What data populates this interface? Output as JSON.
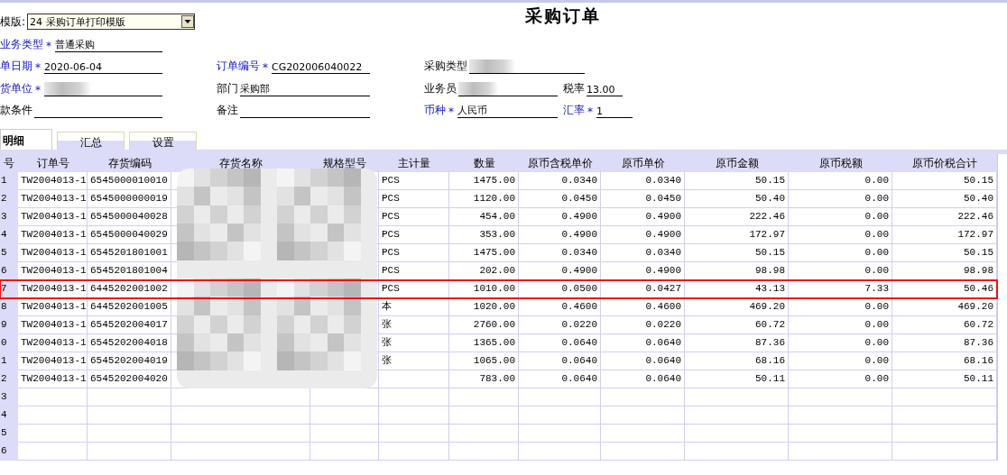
{
  "template": {
    "label": "模版:",
    "value": "24 采购订单打印模版"
  },
  "title": "采购订单",
  "form_rows": [
    [
      {
        "label": "业务类型",
        "required": true,
        "mark": "*",
        "value": "普通采购",
        "redacted": false
      }
    ],
    [
      {
        "label": "单日期",
        "required": true,
        "mark": "*",
        "value": "2020-06-04",
        "redacted": false
      },
      {
        "label": "订单编号",
        "required": true,
        "mark": "*",
        "value": "CG202006040022",
        "redacted": false
      },
      {
        "label": "采购类型",
        "required": false,
        "redacted": true
      }
    ],
    [
      {
        "label": "货单位",
        "required": true,
        "mark": "*",
        "redacted": true
      },
      {
        "label": "部门",
        "required": false,
        "value": "采购部",
        "redacted": false
      },
      {
        "label": "业务员",
        "required": false,
        "redacted": true
      },
      {
        "label": "税率",
        "required": false,
        "value": "13.00",
        "redacted": false
      }
    ],
    [
      {
        "label": "款条件",
        "required": false,
        "redacted": false
      },
      {
        "label": "备注",
        "required": false,
        "redacted": false
      },
      {
        "label": "币种",
        "required": true,
        "mark": "*",
        "value": "人民币",
        "redacted": false
      },
      {
        "label": "汇率",
        "required": true,
        "mark": "*",
        "value": "1",
        "redacted": false
      }
    ]
  ],
  "tabs": [
    {
      "label": "明细",
      "selected": true
    },
    {
      "label": "汇总",
      "selected": false
    },
    {
      "label": "设置",
      "selected": false
    }
  ],
  "table": {
    "columns": [
      {
        "label": "号",
        "kind": "index"
      },
      {
        "label": "订单号",
        "kind": "text"
      },
      {
        "label": "存货编码",
        "kind": "text"
      },
      {
        "label": "存货名称",
        "kind": "text"
      },
      {
        "label": "规格型号",
        "kind": "text"
      },
      {
        "label": "主计量",
        "kind": "text"
      },
      {
        "label": "数量",
        "kind": "number"
      },
      {
        "label": "原币含税单价",
        "kind": "number"
      },
      {
        "label": "原币单价",
        "kind": "number"
      },
      {
        "label": "原币金额",
        "kind": "number"
      },
      {
        "label": "原币税额",
        "kind": "number"
      },
      {
        "label": "原币价税合计",
        "kind": "number"
      }
    ],
    "rows": [
      {
        "cells": [
          "1",
          "TW2004013-1",
          "6545000010010",
          null,
          null,
          "PCS",
          "1475.00",
          "0.0340",
          "0.0340",
          "50.15",
          "0.00",
          "50.15"
        ],
        "highlighted": false
      },
      {
        "cells": [
          "2",
          "TW2004013-1",
          "6545000000019",
          null,
          null,
          "PCS",
          "1120.00",
          "0.0450",
          "0.0450",
          "50.40",
          "0.00",
          "50.40"
        ],
        "highlighted": false
      },
      {
        "cells": [
          "3",
          "TW2004013-1",
          "6545000040028",
          null,
          null,
          "PCS",
          "454.00",
          "0.4900",
          "0.4900",
          "222.46",
          "0.00",
          "222.46"
        ],
        "highlighted": false
      },
      {
        "cells": [
          "4",
          "TW2004013-1",
          "6545000040029",
          null,
          null,
          "PCS",
          "353.00",
          "0.4900",
          "0.4900",
          "172.97",
          "0.00",
          "172.97"
        ],
        "highlighted": false
      },
      {
        "cells": [
          "5",
          "TW2004013-1",
          "6545201801001",
          null,
          null,
          "PCS",
          "1475.00",
          "0.0340",
          "0.0340",
          "50.15",
          "0.00",
          "50.15"
        ],
        "highlighted": false
      },
      {
        "cells": [
          "6",
          "TW2004013-1",
          "6545201801004",
          null,
          null,
          "PCS",
          "202.00",
          "0.4900",
          "0.4900",
          "98.98",
          "0.00",
          "98.98"
        ],
        "highlighted": false
      },
      {
        "cells": [
          "7",
          "TW2004013-1",
          "6445202001002",
          null,
          null,
          "PCS",
          "1010.00",
          "0.0500",
          "0.0427",
          "43.13",
          "7.33",
          "50.46"
        ],
        "highlighted": true
      },
      {
        "cells": [
          "8",
          "TW2004013-1",
          "6445202001005",
          null,
          null,
          "本",
          "1020.00",
          "0.4600",
          "0.4600",
          "469.20",
          "0.00",
          "469.20"
        ],
        "highlighted": false
      },
      {
        "cells": [
          "9",
          "TW2004013-1",
          "6545202004017",
          null,
          null,
          "张",
          "2760.00",
          "0.0220",
          "0.0220",
          "60.72",
          "0.00",
          "60.72"
        ],
        "highlighted": false
      },
      {
        "cells": [
          "0",
          "TW2004013-1",
          "6545202004018",
          null,
          null,
          "张",
          "1365.00",
          "0.0640",
          "0.0640",
          "87.36",
          "0.00",
          "87.36"
        ],
        "highlighted": false
      },
      {
        "cells": [
          "1",
          "TW2004013-1",
          "6545202004019",
          null,
          null,
          "张",
          "1065.00",
          "0.0640",
          "0.0640",
          "68.16",
          "0.00",
          "68.16"
        ],
        "highlighted": false
      },
      {
        "cells": [
          "2",
          "TW2004013-1",
          "6545202004020",
          null,
          null,
          null,
          "783.00",
          "0.0640",
          "0.0640",
          "50.11",
          "0.00",
          "50.11"
        ],
        "highlighted": false
      },
      {
        "cells": [
          "3"
        ],
        "highlighted": false
      },
      {
        "cells": [
          "4"
        ],
        "highlighted": false
      },
      {
        "cells": [
          "5"
        ],
        "highlighted": false
      },
      {
        "cells": [
          "6"
        ],
        "highlighted": false
      }
    ]
  }
}
